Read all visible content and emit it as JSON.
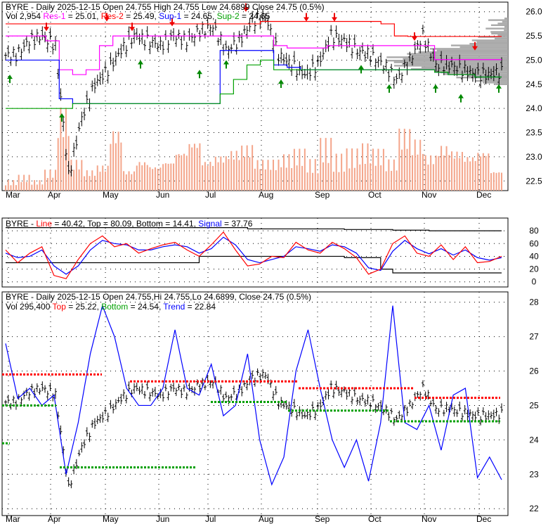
{
  "chart_data": [
    {
      "type": "line",
      "title_parts": {
        "ticker": "BYRE - Daily 2025-12-15 Open 24.755  High 24.755  Low 24.6899  Close 24.75 (0.5%)",
        "vol": "Vol 2,954",
        "res1": "Res-1",
        "res1_val": " = 25.01,",
        "res2": "Res-2",
        "res2_val": " = 25.49,",
        "sup1": "Sup-1",
        "sup1_val": " = 24.65,",
        "sup2": "Sup-2",
        "sup2_val": " = 24.65"
      },
      "yticks": [
        "26.0",
        "25.5",
        "25.0",
        "24.5",
        "24.0",
        "23.5",
        "23.0",
        "22.5"
      ],
      "ylim": [
        22.3,
        26.2
      ],
      "closes": [
        25.1,
        25.4,
        25.5,
        25.3,
        22.6,
        23.8,
        24.5,
        24.8,
        25.2,
        25.5,
        25.4,
        25.3,
        25.5,
        25.4,
        25.6,
        25.7,
        25.2,
        25.4,
        25.8,
        25.9,
        25.1,
        24.9,
        24.7,
        24.9,
        25.5,
        25.4,
        25.2,
        25.1,
        24.9,
        24.6,
        25.0,
        25.5,
        24.9,
        24.9,
        24.8,
        24.7,
        24.7,
        24.75
      ],
      "volume": [
        0.1,
        0.15,
        0.1,
        0.2,
        0.8,
        0.3,
        0.2,
        0.25,
        0.6,
        0.2,
        0.3,
        0.25,
        0.3,
        0.4,
        0.5,
        0.3,
        0.35,
        0.4,
        0.45,
        0.3,
        0.3,
        0.35,
        0.4,
        0.3,
        0.5,
        0.35,
        0.4,
        0.45,
        0.4,
        0.3,
        0.6,
        0.5,
        0.35,
        0.45,
        0.4,
        0.35,
        0.4,
        0.2
      ],
      "res1": [
        25.5,
        25.5,
        25.5,
        25.4,
        24.8,
        24.7,
        24.8,
        25.3,
        25.5,
        25.5,
        25.5,
        25.5,
        25.5,
        25.5,
        25.5,
        25.5,
        25.5,
        25.5,
        25.5,
        25.5,
        25.3,
        25.25,
        25.25,
        25.25,
        25.3,
        25.3,
        25.3,
        25.3,
        25.3,
        25.3,
        25.3,
        25.3,
        25.01,
        25.01,
        25.01,
        25.01,
        25.01,
        25.01
      ],
      "res2": [
        25.75,
        25.75,
        25.75,
        25.75,
        25.75,
        25.75,
        25.75,
        25.75,
        25.75,
        25.75,
        25.75,
        25.75,
        25.75,
        25.75,
        25.75,
        25.75,
        25.75,
        25.75,
        25.75,
        25.8,
        25.8,
        25.8,
        25.8,
        25.8,
        25.8,
        25.8,
        25.8,
        25.8,
        25.75,
        25.5,
        25.49,
        25.49,
        25.49,
        25.49,
        25.49,
        25.49,
        25.49,
        25.49
      ],
      "sup1": [
        25.0,
        25.0,
        25.0,
        25.0,
        24.2,
        24.1,
        24.1,
        24.1,
        24.1,
        24.1,
        24.1,
        24.1,
        24.1,
        24.1,
        24.1,
        24.1,
        25.2,
        25.2,
        25.2,
        25.2,
        24.9,
        24.85,
        24.8,
        24.8,
        24.8,
        24.8,
        24.8,
        24.8,
        24.8,
        24.8,
        24.8,
        24.8,
        24.75,
        24.7,
        24.7,
        24.65,
        24.65,
        24.65
      ],
      "sup2": [
        24.0,
        24.0,
        24.0,
        24.0,
        24.0,
        24.1,
        24.1,
        24.1,
        24.1,
        24.1,
        24.1,
        24.1,
        24.1,
        24.1,
        24.1,
        24.1,
        24.3,
        24.6,
        24.9,
        25.0,
        24.8,
        24.8,
        24.8,
        24.8,
        24.8,
        24.8,
        24.8,
        24.8,
        24.8,
        24.8,
        24.8,
        24.8,
        24.75,
        24.7,
        24.7,
        24.65,
        24.65,
        24.65
      ]
    },
    {
      "type": "line",
      "title_parts": {
        "ticker": "BYRE - ",
        "line": "Line",
        "line_val": " = 40.42, Top = 80.09, Bottom = 14.41, ",
        "signal": "Signal",
        "signal_val": " = 37.76"
      },
      "yticks": [
        "80",
        "60",
        "40",
        "20",
        "0"
      ],
      "ylim": [
        0,
        100
      ],
      "line": [
        50,
        30,
        45,
        55,
        10,
        5,
        35,
        60,
        72,
        55,
        60,
        45,
        52,
        58,
        62,
        50,
        40,
        58,
        78,
        50,
        25,
        28,
        40,
        38,
        62,
        50,
        45,
        62,
        52,
        38,
        12,
        20,
        60,
        72,
        45,
        40,
        58,
        35,
        55,
        30,
        32,
        40
      ],
      "signal": [
        45,
        38,
        40,
        50,
        25,
        12,
        25,
        50,
        65,
        60,
        58,
        50,
        50,
        55,
        58,
        55,
        45,
        52,
        70,
        58,
        35,
        30,
        35,
        40,
        55,
        52,
        48,
        58,
        55,
        45,
        22,
        18,
        48,
        65,
        52,
        44,
        52,
        42,
        50,
        38,
        34,
        38
      ],
      "top": [
        85,
        85,
        85,
        85,
        85,
        85,
        85,
        85,
        85,
        85,
        85,
        85,
        85,
        85,
        85,
        85,
        85,
        85,
        85,
        85,
        83,
        83,
        83,
        83,
        83,
        83,
        83,
        83,
        82,
        82,
        82,
        82,
        81,
        81,
        81,
        80,
        80,
        80,
        80,
        80,
        80,
        80
      ],
      "bottom": [
        30,
        30,
        30,
        30,
        30,
        30,
        30,
        30,
        30,
        30,
        30,
        30,
        30,
        30,
        30,
        30,
        40,
        40,
        40,
        40,
        40,
        40,
        40,
        40,
        40,
        40,
        40,
        40,
        38,
        38,
        38,
        20,
        14,
        14,
        14,
        14,
        14,
        14,
        14,
        14,
        14,
        14
      ]
    },
    {
      "type": "line",
      "title_parts": {
        "ticker": "BYRE - Daily 2025-12-15 Open 24.755,Hi 24.755,Lo 24.6899, Close 24.75 (0.5%)",
        "vol": "Vol 295,400 ",
        "top": "Top",
        "top_val": " = 25.22, ",
        "bottom": "Bottom",
        "bottom_val": " = 24.54, ",
        "trend": "Trend",
        "trend_val": " = 22.84"
      },
      "yticks": [
        "28",
        "27",
        "26",
        "25",
        "24",
        "23",
        "22"
      ],
      "ylim": [
        21.8,
        28.3
      ],
      "trend": [
        26.8,
        25.2,
        25.5,
        25.0,
        25.3,
        23.0,
        24.5,
        26.5,
        27.9,
        27.0,
        25.5,
        25.0,
        25.0,
        25.5,
        27.2,
        25.5,
        25.3,
        26.2,
        24.7,
        25.0,
        26.5,
        24.0,
        22.7,
        23.5,
        26.0,
        27.2,
        25.5,
        24.0,
        23.2,
        24.0,
        22.8,
        24.5,
        27.9,
        24.5,
        24.3,
        25.0,
        23.7,
        25.3,
        25.5,
        22.9,
        23.5,
        22.84
      ]
    }
  ],
  "months": [
    "Mar",
    "Apr",
    "May",
    "Jun",
    "Jul",
    "Aug",
    "Sep",
    "Oct",
    "Nov",
    "Dec"
  ],
  "colors": {
    "res1": "#ff00ff",
    "res2": "#ff0000",
    "sup1": "#0000ff",
    "sup2": "#00a000",
    "volume": "#f4a58a"
  }
}
